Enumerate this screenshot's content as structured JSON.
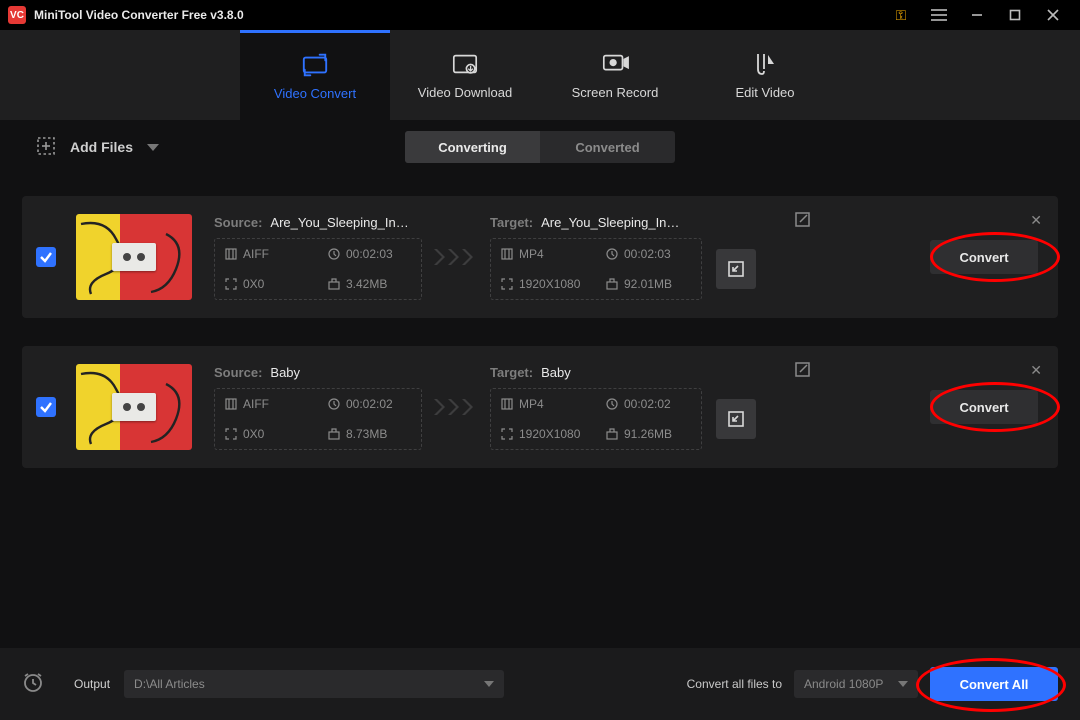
{
  "app": {
    "title": "MiniTool Video Converter Free v3.8.0"
  },
  "nav": {
    "video_convert": "Video Convert",
    "video_download": "Video Download",
    "screen_record": "Screen Record",
    "edit_video": "Edit Video"
  },
  "toolbar": {
    "add_files": "Add Files",
    "converting": "Converting",
    "converted": "Converted"
  },
  "files": [
    {
      "source_label": "Source:",
      "source_name": "Are_You_Sleeping_In…",
      "target_label": "Target:",
      "target_name": "Are_You_Sleeping_In…",
      "src_format": "AIFF",
      "src_duration": "00:02:03",
      "src_res": "0X0",
      "src_size": "3.42MB",
      "tgt_format": "MP4",
      "tgt_duration": "00:02:03",
      "tgt_res": "1920X1080",
      "tgt_size": "92.01MB",
      "convert_label": "Convert"
    },
    {
      "source_label": "Source:",
      "source_name": "Baby",
      "target_label": "Target:",
      "target_name": "Baby",
      "src_format": "AIFF",
      "src_duration": "00:02:02",
      "src_res": "0X0",
      "src_size": "8.73MB",
      "tgt_format": "MP4",
      "tgt_duration": "00:02:02",
      "tgt_res": "1920X1080",
      "tgt_size": "91.26MB",
      "convert_label": "Convert"
    }
  ],
  "footer": {
    "output_label": "Output",
    "output_path": "D:\\All Articles",
    "convert_all_files_label": "Convert all files to",
    "preset": "Android 1080P",
    "convert_all_label": "Convert All"
  }
}
